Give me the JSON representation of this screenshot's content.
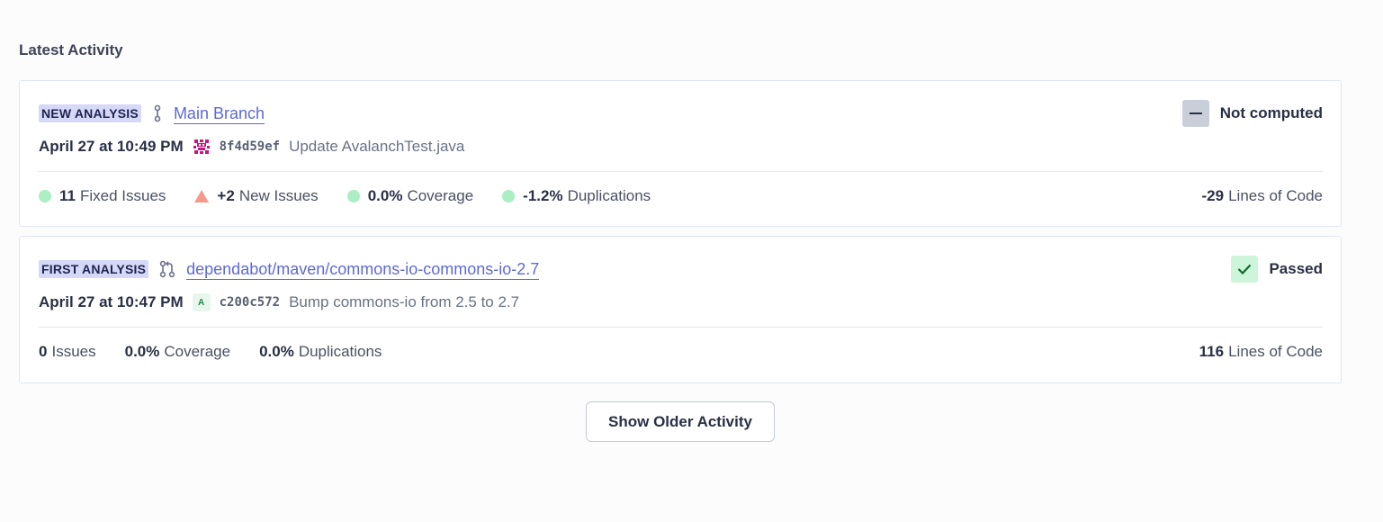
{
  "section_title": "Latest Activity",
  "activities": [
    {
      "badge": "NEW ANALYSIS",
      "branch_icon": "branch-icon",
      "branch": "Main Branch",
      "status": "Not computed",
      "status_icon": "dash-icon",
      "date": "April 27 at 10:49 PM",
      "avatar_icon": "identicon-avatar",
      "commit_hash": "8f4d59ef",
      "commit_message": "Update AvalanchTest.java",
      "metrics": [
        {
          "value": "11",
          "label": "Fixed Issues",
          "indicator": "green-dot"
        },
        {
          "value": "+2",
          "label": "New Issues",
          "indicator": "red-triangle"
        },
        {
          "value": "0.0%",
          "label": "Coverage",
          "indicator": "green-dot"
        },
        {
          "value": "-1.2%",
          "label": "Duplications",
          "indicator": "green-dot"
        }
      ],
      "lines_value": "-29",
      "lines_label": "Lines of Code"
    },
    {
      "badge": "FIRST ANALYSIS",
      "branch_icon": "pull-request-icon",
      "branch": "dependabot/maven/commons-io-commons-io-2.7",
      "status": "Passed",
      "status_icon": "check-icon",
      "date": "April 27 at 10:47 PM",
      "avatar_letter": "A",
      "commit_hash": "c200c572",
      "commit_message": "Bump commons-io from 2.5 to 2.7",
      "metrics": [
        {
          "value": "0",
          "label": "Issues"
        },
        {
          "value": "0.0%",
          "label": "Coverage"
        },
        {
          "value": "0.0%",
          "label": "Duplications"
        }
      ],
      "lines_value": "116",
      "lines_label": "Lines of Code"
    }
  ],
  "show_older_label": "Show Older Activity",
  "colors": {
    "accent": "#5e6ad2",
    "badge_bg": "#d5d9f7",
    "good": "#abeec4",
    "bad": "#f59a8a",
    "passed_bg": "#cdf5da"
  }
}
